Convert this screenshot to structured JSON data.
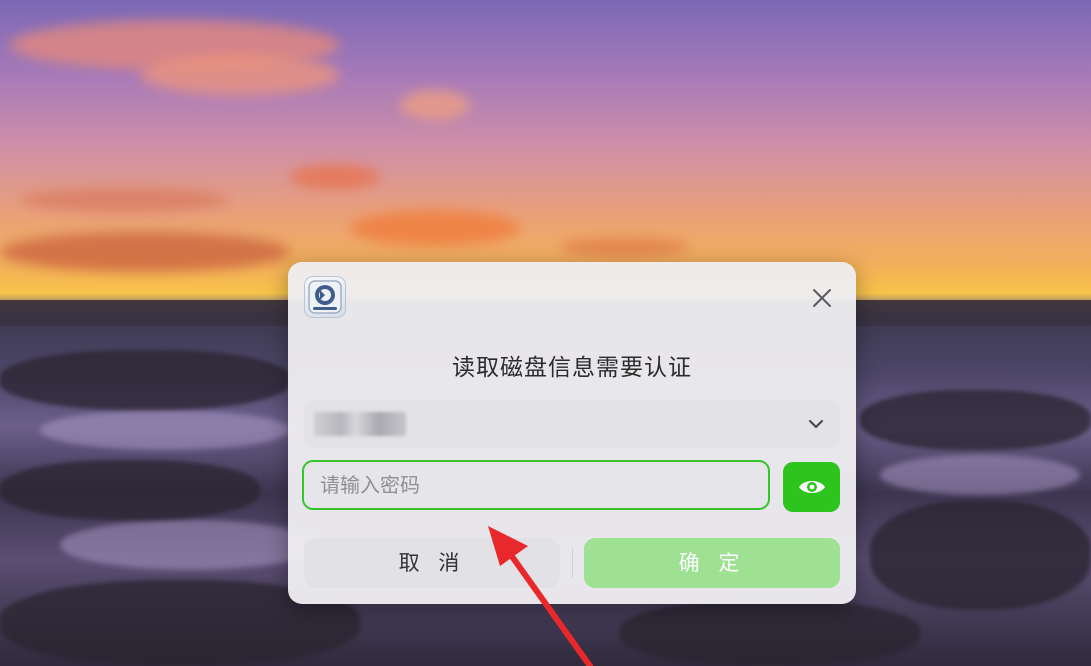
{
  "dialog": {
    "title": "读取磁盘信息需要认证",
    "user_select": {
      "value": ""
    },
    "password": {
      "placeholder": "请输入密码",
      "value": ""
    },
    "cancel_label": "取 消",
    "confirm_label": "确 定"
  },
  "colors": {
    "accent": "#2ec41e",
    "confirm_disabled": "#9ee193",
    "focus_border": "#35c52a",
    "annotation_arrow": "#e8282a"
  },
  "icons": [
    "disk-utility-icon",
    "close-icon",
    "chevron-down-icon",
    "eye-icon"
  ]
}
